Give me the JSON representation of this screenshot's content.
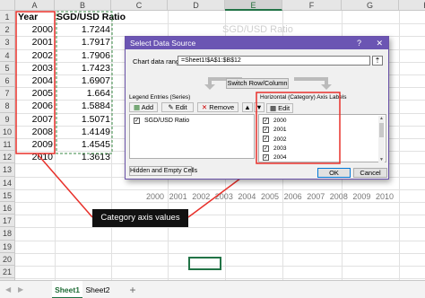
{
  "columns": [
    "A",
    "B",
    "C",
    "D",
    "E",
    "F",
    "G",
    "H"
  ],
  "rows": [
    "1",
    "2",
    "3",
    "4",
    "5",
    "6",
    "7",
    "8",
    "9",
    "10",
    "11",
    "12",
    "13",
    "14",
    "15",
    "16",
    "17",
    "18",
    "19",
    "20",
    "21",
    "22",
    "23"
  ],
  "table": {
    "header": {
      "year": "Year",
      "ratio": "SGD/USD Ratio"
    },
    "data": [
      {
        "year": "2000",
        "ratio": "1.7244"
      },
      {
        "year": "2001",
        "ratio": "1.7917"
      },
      {
        "year": "2002",
        "ratio": "1.7906"
      },
      {
        "year": "2003",
        "ratio": "1.7423"
      },
      {
        "year": "2004",
        "ratio": "1.6907"
      },
      {
        "year": "2005",
        "ratio": "1.664"
      },
      {
        "year": "2006",
        "ratio": "1.5884"
      },
      {
        "year": "2007",
        "ratio": "1.5071"
      },
      {
        "year": "2008",
        "ratio": "1.4149"
      },
      {
        "year": "2009",
        "ratio": "1.4545"
      },
      {
        "year": "2010",
        "ratio": "1.3613"
      }
    ]
  },
  "chart_background": {
    "title": "SGD/USD Ratio",
    "x_ticks": [
      "2000",
      "2001",
      "2002",
      "2003",
      "2004",
      "2005",
      "2006",
      "2007",
      "2008",
      "2009",
      "2010"
    ]
  },
  "dialog": {
    "title": "Select Data Source",
    "help": "?",
    "close": "✕",
    "range_label": "Chart data range:",
    "range_value": "=Sheet1!$A$1:$B$12",
    "switch_label": "Switch Row/Column",
    "legend_label": "Legend Entries (Series)",
    "legend_add": "Add",
    "legend_edit": "Edit",
    "legend_remove": "Remove",
    "series": [
      "SGD/USD Ratio"
    ],
    "axis_label": "Horizontal (Category) Axis Labels",
    "axis_edit": "Edit",
    "axis_items": [
      "2000",
      "2001",
      "2002",
      "2003",
      "2004"
    ],
    "hidden_cells": "Hidden and Empty Cells",
    "ok": "OK",
    "cancel": "Cancel"
  },
  "callout": "Category axis values",
  "sheets": [
    "Sheet1",
    "Sheet2"
  ],
  "new_sheet": "+",
  "colors": {
    "highlight": "#e8302a",
    "dialog_title": "#6b55b3",
    "excel_green": "#217346"
  }
}
